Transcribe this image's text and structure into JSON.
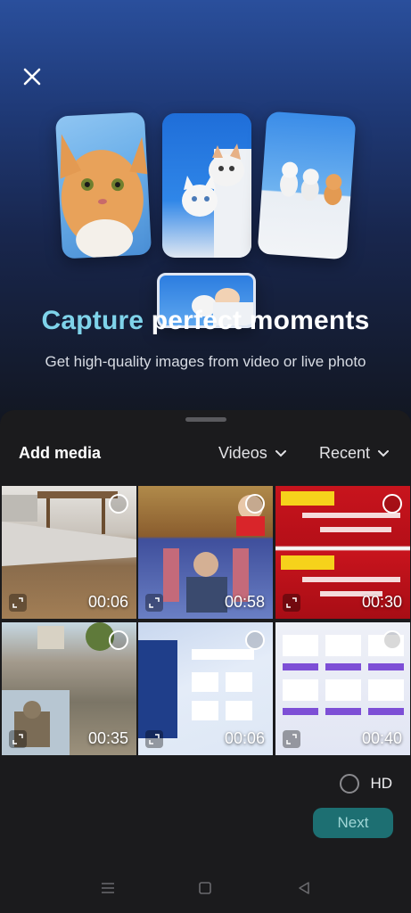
{
  "hero": {
    "headline_accent": "Capture",
    "headline_rest": " perfect moments",
    "subhead": "Get high-quality images from video or live photo"
  },
  "sheet": {
    "title": "Add media",
    "filter_type": "Videos",
    "filter_sort": "Recent"
  },
  "media": [
    {
      "duration": "00:06"
    },
    {
      "duration": "00:58"
    },
    {
      "duration": "00:30"
    },
    {
      "duration": "00:35"
    },
    {
      "duration": "00:06"
    },
    {
      "duration": "00:40"
    }
  ],
  "footer": {
    "hd_label": "HD",
    "next_label": "Next"
  },
  "colors": {
    "accent": "#7fd3ea",
    "next_button": "#1d6f72"
  }
}
